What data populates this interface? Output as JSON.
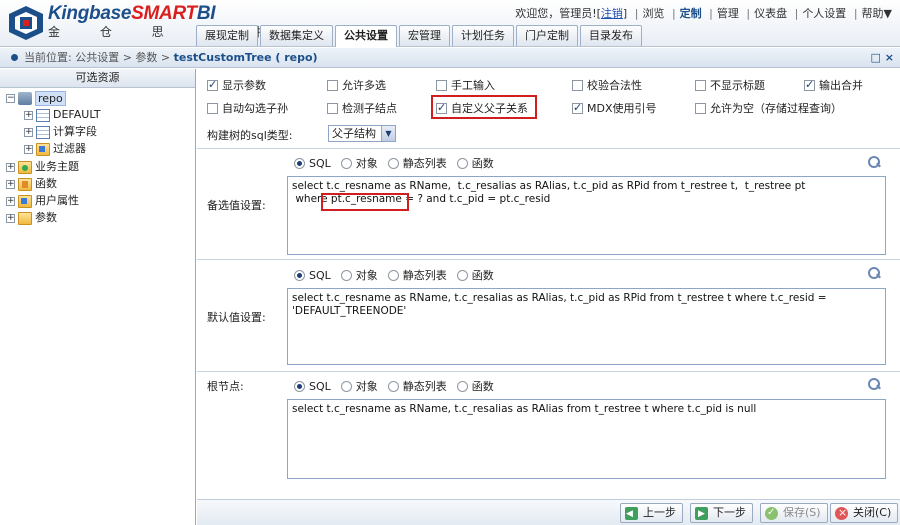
{
  "header": {
    "brand_part1": "Kingbase",
    "brand_part2": "SMART",
    "brand_part3": "BI",
    "brand_sub": "金 仓 思 迈 特",
    "welcome": "欢迎您，管理员!",
    "logout": "注销",
    "nav": [
      "浏览",
      "定制",
      "管理",
      "仪表盘",
      "个人设置",
      "帮助▼"
    ]
  },
  "tabs": [
    {
      "label": "展现定制",
      "active": false
    },
    {
      "label": "数据集定义",
      "active": false
    },
    {
      "label": "公共设置",
      "active": true
    },
    {
      "label": "宏管理",
      "active": false
    },
    {
      "label": "计划任务",
      "active": false
    },
    {
      "label": "门户定制",
      "active": false
    },
    {
      "label": "目录发布",
      "active": false
    }
  ],
  "breadcrumb": {
    "prefix": "当前位置:",
    "path": "公共设置 > 参数 >",
    "title": "testCustomTree ( repo)",
    "window_buttons": "□ ×"
  },
  "left": {
    "header": "可选资源",
    "tree": {
      "repo": "repo",
      "default": "DEFAULT",
      "calc_field": "计算字段",
      "filter": "过滤器",
      "business": "业务主题",
      "function": "函数",
      "user_attr": "用户属性",
      "params": "参数"
    }
  },
  "options": {
    "row1": [
      {
        "label": "显示参数",
        "checked": true
      },
      {
        "label": "允许多选",
        "checked": false
      },
      {
        "label": "手工输入",
        "checked": false
      },
      {
        "label": "校验合法性",
        "checked": false
      },
      {
        "label": "不显示标题",
        "checked": false
      },
      {
        "label": "输出合并",
        "checked": true
      }
    ],
    "row2": [
      {
        "label": "自动勾选子孙",
        "checked": false
      },
      {
        "label": "检测子结点",
        "checked": false
      },
      {
        "label": "自定义父子关系",
        "checked": true
      },
      {
        "label": "MDX使用引号",
        "checked": true
      },
      {
        "label": "允许为空（存储过程查询）",
        "checked": false
      }
    ]
  },
  "sql_type": {
    "label": "构建树的sql类型:",
    "value": "父子结构"
  },
  "sections": [
    {
      "label": "备选值设置:",
      "radios": [
        "SQL",
        "对象",
        "静态列表",
        "函数"
      ],
      "selected": "SQL",
      "sql": "select t.c_resname as RName,  t.c_resalias as RAlias, t.c_pid as RPid from t_restree t,  t_restree pt\n where pt.c_resname = ? and t.c_pid = pt.c_resid"
    },
    {
      "label": "默认值设置:",
      "radios": [
        "SQL",
        "对象",
        "静态列表",
        "函数"
      ],
      "selected": "SQL",
      "sql": "select t.c_resname as RName, t.c_resalias as RAlias, t.c_pid as RPid from t_restree t where t.c_resid = 'DEFAULT_TREENODE'"
    },
    {
      "label": "根节点:",
      "radios": [
        "SQL",
        "对象",
        "静态列表",
        "函数"
      ],
      "selected": "SQL",
      "sql": "select t.c_resname as RName, t.c_resalias as RAlias from t_restree t where t.c_pid is null"
    }
  ],
  "footer": {
    "prev": "上一步",
    "next": "下一步",
    "save": "保存(S)",
    "close": "关闭(C)"
  }
}
